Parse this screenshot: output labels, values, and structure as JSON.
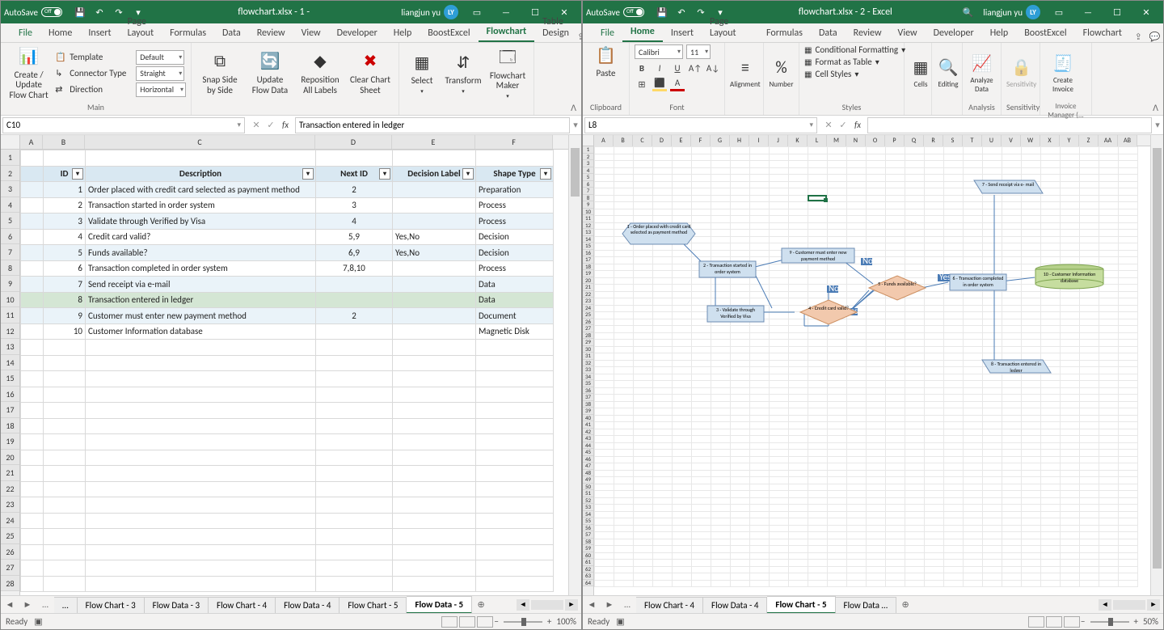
{
  "left": {
    "titlebar": {
      "autosave_label": "AutoSave",
      "autosave_state": "Off",
      "title": "flowchart.xlsx  -  1  -",
      "user": "liangjun yu",
      "initials": "LY"
    },
    "tabs": [
      "File",
      "Home",
      "Insert",
      "Page Layout",
      "Formulas",
      "Data",
      "Review",
      "View",
      "Developer",
      "Help",
      "BoostExcel",
      "Flowchart",
      "Table Design"
    ],
    "active_tab": "Flowchart",
    "ribbon": {
      "main": {
        "template_label": "Template",
        "template_value": "Default",
        "connector_label": "Connector Type",
        "connector_value": "Straight",
        "direction_label": "Direction",
        "direction_value": "Horizontal",
        "createupdate": "Create / Update\nFlow Chart",
        "group_label": "Main"
      },
      "btn_snap": "Snap Side\nby Side",
      "btn_update": "Update\nFlow Data",
      "btn_repos": "Reposition\nAll Labels",
      "btn_clear": "Clear Chart\nSheet",
      "btn_select": "Select",
      "btn_transform": "Transform",
      "btn_maker": "Flowchart\nMaker"
    },
    "namebox": "C10",
    "formula": "Transaction entered in ledger",
    "columns": [
      "A",
      "B",
      "C",
      "D",
      "E",
      "F"
    ],
    "header_row": {
      "id": "ID",
      "desc": "Description",
      "next": "Next ID",
      "dec": "Decision Label",
      "shape": "Shape Type"
    },
    "rows": [
      {
        "id": 1,
        "desc": "Order placed with credit card selected as payment method",
        "next": "2",
        "dec": "",
        "shape": "Preparation"
      },
      {
        "id": 2,
        "desc": "Transaction started in order system",
        "next": "3",
        "dec": "",
        "shape": "Process"
      },
      {
        "id": 3,
        "desc": "Validate through Verified by Visa",
        "next": "4",
        "dec": "",
        "shape": "Process"
      },
      {
        "id": 4,
        "desc": "Credit card valid?",
        "next": "5,9",
        "dec": "Yes,No",
        "shape": "Decision"
      },
      {
        "id": 5,
        "desc": "Funds available?",
        "next": "6,9",
        "dec": "Yes,No",
        "shape": "Decision"
      },
      {
        "id": 6,
        "desc": "Transaction completed in order system",
        "next": "7,8,10",
        "dec": "",
        "shape": "Process"
      },
      {
        "id": 7,
        "desc": "Send receipt via e-mail",
        "next": "",
        "dec": "",
        "shape": "Data"
      },
      {
        "id": 8,
        "desc": "Transaction entered in ledger",
        "next": "",
        "dec": "",
        "shape": "Data"
      },
      {
        "id": 9,
        "desc": "Customer must enter new payment method",
        "next": "2",
        "dec": "",
        "shape": "Document"
      },
      {
        "id": 10,
        "desc": "Customer Information database",
        "next": "",
        "dec": "",
        "shape": "Magnetic Disk"
      }
    ],
    "selected_row_index": 7,
    "sheet_tabs": [
      "…",
      "Flow Chart - 3",
      "Flow Data - 3",
      "Flow Chart - 4",
      "Flow Data - 4",
      "Flow Chart - 5",
      "Flow Data - 5"
    ],
    "active_sheet": "Flow Data - 5",
    "status_ready": "Ready",
    "zoom": "100%"
  },
  "right": {
    "titlebar": {
      "autosave_label": "AutoSave",
      "autosave_state": "Off",
      "title": "flowchart.xlsx  -  2  -  Excel",
      "user": "liangjun yu",
      "initials": "LY"
    },
    "tabs": [
      "File",
      "Home",
      "Insert",
      "Page Layout",
      "Formulas",
      "Data",
      "Review",
      "View",
      "Developer",
      "Help",
      "BoostExcel",
      "Flowchart"
    ],
    "active_tab": "Home",
    "ribbon": {
      "paste": "Paste",
      "clipboard": "Clipboard",
      "font_name": "Calibri",
      "font_size": "11",
      "font": "Font",
      "alignment": "Alignment",
      "number": "Number",
      "cond": "Conditional Formatting",
      "fmttable": "Format as Table",
      "cellstyles": "Cell Styles",
      "styles": "Styles",
      "cells": "Cells",
      "editing": "Editing",
      "analyze": "Analyze\nData",
      "analysis": "Analysis",
      "sensitivity": "Sensitivity",
      "sensgroup": "Sensitivity",
      "invoice": "Create\nInvoice",
      "invoicegroup": "Invoice Manager (..."
    },
    "namebox": "L8",
    "formula": "",
    "columns": [
      "A",
      "B",
      "C",
      "D",
      "E",
      "F",
      "G",
      "H",
      "I",
      "J",
      "K",
      "L",
      "M",
      "N",
      "O",
      "P",
      "Q",
      "R",
      "S",
      "T",
      "U",
      "V",
      "W",
      "X",
      "Y",
      "Z",
      "AA",
      "AB"
    ],
    "selected_cell": {
      "col": 11,
      "row": 7
    },
    "shapes": {
      "s1": "1 - Order placed with\ncredit card selected as\npayment method",
      "s2": "2 - Transaction started in\norder system",
      "s3": "3 - Validate through\nVerified by Visa",
      "s4": "4 - Credit card\nvalid?",
      "s5": "5 - Funds\navailable?",
      "s6": "6 - Transaction completed\nin order system",
      "s7": "7 - Send receipt via e-\nmail",
      "s8": "8 - Transaction entered\nin ledger",
      "s9": "9 - Customer must enter new\npayment method",
      "s10": "10 - Customer Information\ndatabase",
      "yes": "Yes",
      "no": "No"
    },
    "sheet_tabs": [
      "Flow Chart - 4",
      "Flow Data - 4",
      "Flow Chart - 5",
      "Flow Data  …"
    ],
    "active_sheet": "Flow Chart - 5",
    "status_ready": "Ready",
    "zoom": "50%"
  }
}
